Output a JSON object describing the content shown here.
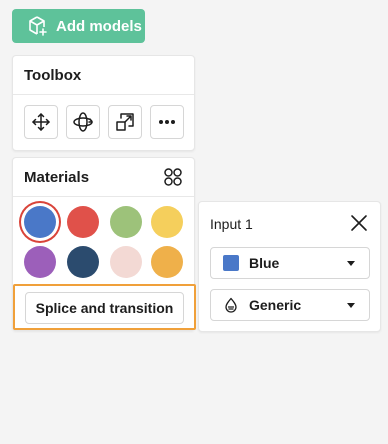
{
  "add_models": {
    "label": "Add models",
    "icon": "cube-plus-icon"
  },
  "toolbox": {
    "title": "Toolbox",
    "tools": [
      {
        "name": "move-icon"
      },
      {
        "name": "rotate-icon"
      },
      {
        "name": "scale-icon"
      },
      {
        "name": "more-icon"
      }
    ]
  },
  "materials": {
    "title": "Materials",
    "swatches": [
      "#4a78c8",
      "#e0514a",
      "#9dc27a",
      "#f5cf5c",
      "#9c5fba",
      "#2b4b6e",
      "#f3d9d4",
      "#efb04a"
    ],
    "selected_index": 0,
    "splice_label": "Splice and transition"
  },
  "input": {
    "title": "Input 1",
    "color_value": "Blue",
    "color_hex": "#4a78c8",
    "type_value": "Generic"
  }
}
